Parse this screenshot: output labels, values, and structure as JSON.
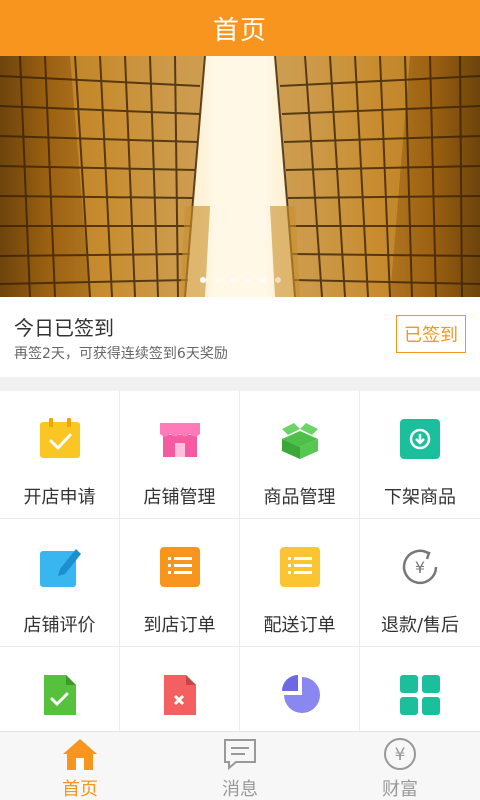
{
  "header": {
    "title": "首页"
  },
  "banner": {
    "slide_count": 6,
    "active_index": 0
  },
  "signin": {
    "title": "今日已签到",
    "subtitle": "再签2天，可获得连续签到6天奖励",
    "button": "已签到"
  },
  "grid": {
    "items": [
      {
        "label": "开店申请",
        "icon": "calendar-check-icon"
      },
      {
        "label": "店铺管理",
        "icon": "storefront-icon"
      },
      {
        "label": "商品管理",
        "icon": "package-box-icon"
      },
      {
        "label": "下架商品",
        "icon": "download-arrow-icon"
      },
      {
        "label": "店铺评价",
        "icon": "edit-pencil-icon"
      },
      {
        "label": "到店订单",
        "icon": "list-orange-icon"
      },
      {
        "label": "配送订单",
        "icon": "list-yellow-icon"
      },
      {
        "label": "退款/售后",
        "icon": "refund-yen-icon"
      },
      {
        "label": "",
        "icon": "document-check-icon"
      },
      {
        "label": "",
        "icon": "document-delete-icon"
      },
      {
        "label": "",
        "icon": "pie-chart-icon"
      },
      {
        "label": "",
        "icon": "apps-grid-icon"
      }
    ]
  },
  "tabbar": {
    "tabs": [
      {
        "label": "首页",
        "icon": "home-icon",
        "active": true
      },
      {
        "label": "消息",
        "icon": "message-icon",
        "active": false
      },
      {
        "label": "财富",
        "icon": "wealth-yen-icon",
        "active": false
      }
    ]
  },
  "colors": {
    "accent": "#f7951e",
    "text": "#333333",
    "subtext": "#666666"
  }
}
